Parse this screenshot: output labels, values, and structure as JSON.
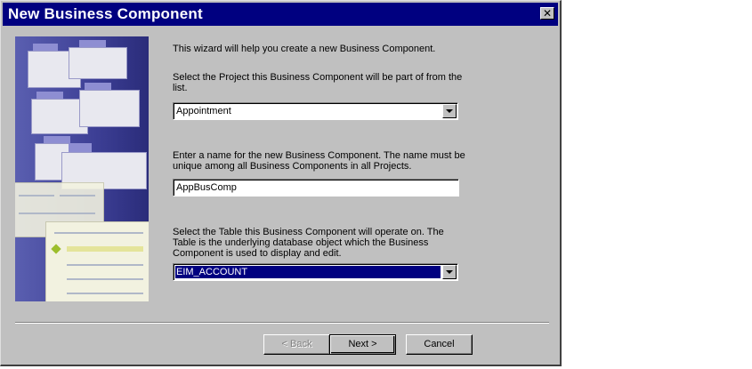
{
  "window": {
    "title": "New Business Component",
    "close_glyph": "✕"
  },
  "intro": "This wizard will help you create a new Business Component.",
  "project": {
    "label_line1": "Select the Project this Business Component will be part of from the",
    "label_line2": "list.",
    "value": "Appointment"
  },
  "name": {
    "label_line1": "Enter a name for the new Business Component.  The name must be",
    "label_line2": "unique among all Business Components in all Projects.",
    "value": "AppBusComp"
  },
  "table": {
    "label_line1": "Select the Table this Business Component will operate on. The",
    "label_line2": "Table is the underlying database object which the Business",
    "label_line3": "Component is used to display and edit.",
    "value": "EIM_ACCOUNT"
  },
  "buttons": {
    "back": "< Back",
    "next": "Next >",
    "cancel": "Cancel"
  },
  "icons": {
    "close": "close-icon",
    "dropdown": "chevron-down-icon"
  }
}
